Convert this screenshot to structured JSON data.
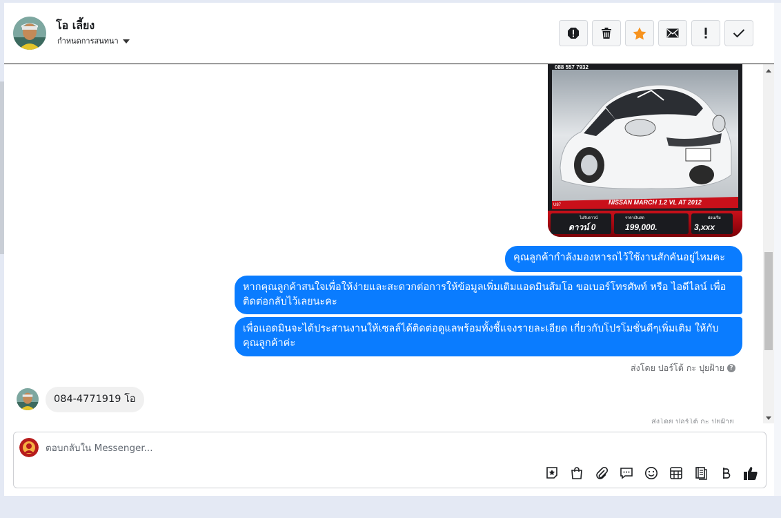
{
  "header": {
    "contact_name": "โอ เลี้ยง",
    "conversation_settings": "กำหนดการสนทนา",
    "actions": [
      {
        "name": "spam-icon",
        "label": "Mark as spam"
      },
      {
        "name": "trash-icon",
        "label": "Delete"
      },
      {
        "name": "star-icon",
        "label": "Star"
      },
      {
        "name": "envelope-icon",
        "label": "Mark unread"
      },
      {
        "name": "exclamation-icon",
        "label": "Follow up"
      },
      {
        "name": "check-icon",
        "label": "Done"
      }
    ],
    "star_color": "#f7931e"
  },
  "car_ad": {
    "phone": "088 557 7932",
    "model": "NISSAN MARCH 1.2 VL AT 2012",
    "down_label": "ไม่รับดาวน์",
    "down_value": "ดาวน์ 0",
    "price_label": "ราคาเงินสด",
    "price": "199,000.",
    "installment_label": "ผ่อนเริ่ม",
    "installment": "3,xxx"
  },
  "messages": {
    "outgoing": [
      "คุณลูกค้ากำลังมองหารถไว้ใช้งานสักคันอยู่ไหมคะ",
      "หากคุณลูกค้าสนใจเพื่อให้ง่ายและสะดวกต่อการให้ข้อมูลเพิ่มเติมแอดมินส้มโอ ขอเบอร์โทรศัพท์ หรือ ไอดีไลน์ เพื่อติดต่อกลับไว้เลยนะคะ",
      "เพื่อแอดมินจะได้ประสานงานให้เซลล์ได้ติดต่อดูแลพร้อมทั้งชี้แจงรายละเอียด เกี่ยวกับโปรโมชั่นดีๆเพิ่มเติม ให้กับคุณลูกค้าค่ะ"
    ],
    "sent_by": "ส่งโดย ปอร์โต้ กะ ปุยฝ้าย",
    "incoming": "084-4771919 โอ",
    "cut_off": "ส่งโดย ปอร์โต้ กะ ปุยฝ้าย"
  },
  "composer": {
    "placeholder": "ตอบกลับใน Messenger...",
    "tools": [
      "sticker-icon",
      "shopping-bag-icon",
      "attachment-icon",
      "saved-reply-icon",
      "emoji-icon",
      "table-icon",
      "notes-icon",
      "baht-icon",
      "like-icon"
    ]
  },
  "colors": {
    "bubble_out": "#0a7cff",
    "bubble_in": "#f0f0f0"
  }
}
